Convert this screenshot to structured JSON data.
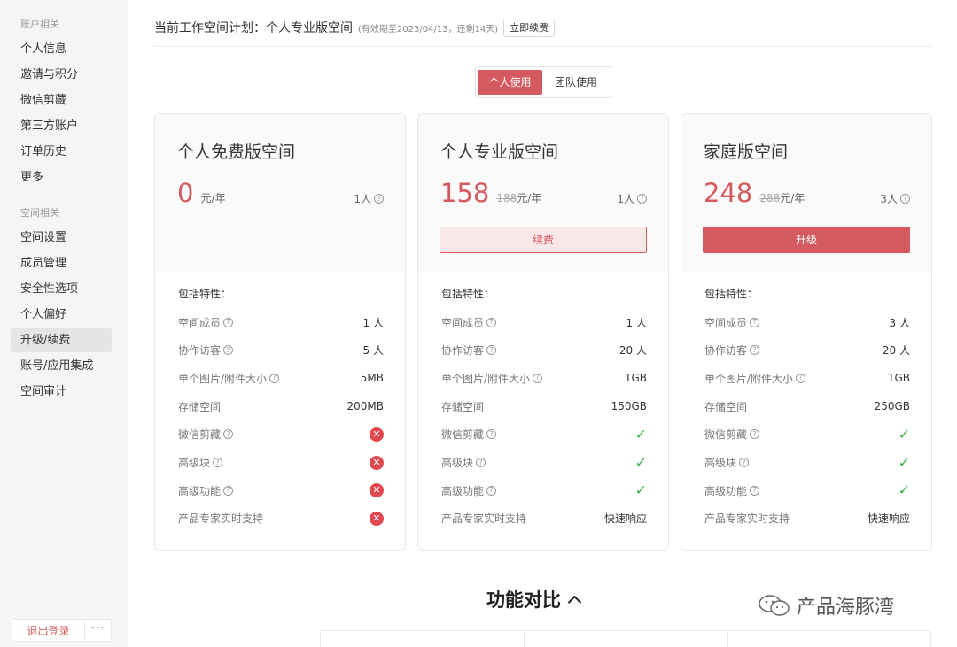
{
  "sidebar": {
    "group_account": "账户相关",
    "account_items": [
      "个人信息",
      "邀请与积分",
      "微信剪藏",
      "第三方账户",
      "订单历史",
      "更多"
    ],
    "group_space": "空间相关",
    "space_items": [
      "空间设置",
      "成员管理",
      "安全性选项",
      "个人偏好",
      "升级/续费",
      "账号/应用集成",
      "空间审计"
    ],
    "active_item": "升级/续费",
    "logout_label": "退出登录",
    "more_label": "···"
  },
  "header": {
    "plan_label": "当前工作空间计划：个人专业版空间",
    "plan_note": "(有效期至2023/04/13，还剩14天)",
    "renew_now_label": "立即续费"
  },
  "toggle": {
    "personal": "个人使用",
    "team": "团队使用",
    "selected": "个人使用"
  },
  "plans": [
    {
      "name": "个人免费版空间",
      "price": "0",
      "original_price": "",
      "unit": "元/年",
      "members": "1人",
      "action": "",
      "features_title": "包括特性：",
      "features": [
        {
          "name": "空间成员",
          "help": true,
          "value": "1 人"
        },
        {
          "name": "协作访客",
          "help": true,
          "value": "5 人"
        },
        {
          "name": "单个图片/附件大小",
          "help": true,
          "value": "5MB"
        },
        {
          "name": "存储空间",
          "help": false,
          "value": "200MB"
        },
        {
          "name": "微信剪藏",
          "help": true,
          "value": "✕"
        },
        {
          "name": "高级块",
          "help": true,
          "value": "✕"
        },
        {
          "name": "高级功能",
          "help": true,
          "value": "✕"
        },
        {
          "name": "产品专家实时支持",
          "help": false,
          "value": "✕"
        }
      ]
    },
    {
      "name": "个人专业版空间",
      "price": "158",
      "original_price": "188",
      "unit": "元/年",
      "members": "1人",
      "action": "续费",
      "features_title": "包括特性：",
      "features": [
        {
          "name": "空间成员",
          "help": true,
          "value": "1 人"
        },
        {
          "name": "协作访客",
          "help": true,
          "value": "20 人"
        },
        {
          "name": "单个图片/附件大小",
          "help": true,
          "value": "1GB"
        },
        {
          "name": "存储空间",
          "help": false,
          "value": "150GB"
        },
        {
          "name": "微信剪藏",
          "help": true,
          "value": "✓"
        },
        {
          "name": "高级块",
          "help": true,
          "value": "✓"
        },
        {
          "name": "高级功能",
          "help": true,
          "value": "✓"
        },
        {
          "name": "产品专家实时支持",
          "help": false,
          "value": "快速响应"
        }
      ]
    },
    {
      "name": "家庭版空间",
      "price": "248",
      "original_price": "288",
      "unit": "元/年",
      "members": "3人",
      "action": "升级",
      "features_title": "包括特性：",
      "features": [
        {
          "name": "空间成员",
          "help": true,
          "value": "3 人"
        },
        {
          "name": "协作访客",
          "help": true,
          "value": "20 人"
        },
        {
          "name": "单个图片/附件大小",
          "help": true,
          "value": "1GB"
        },
        {
          "name": "存储空间",
          "help": false,
          "value": "250GB"
        },
        {
          "name": "微信剪藏",
          "help": true,
          "value": "✓"
        },
        {
          "name": "高级块",
          "help": true,
          "value": "✓"
        },
        {
          "name": "高级功能",
          "help": true,
          "value": "✓"
        },
        {
          "name": "产品专家实时支持",
          "help": false,
          "value": "快速响应"
        }
      ]
    }
  ],
  "compare": {
    "title": "功能对比"
  },
  "watermark": {
    "text": "产品海豚湾"
  },
  "colors": {
    "accent": "#d55a5f",
    "accent_light": "#fbe9ea",
    "check": "#3bb34a",
    "cross": "#e0474f"
  }
}
